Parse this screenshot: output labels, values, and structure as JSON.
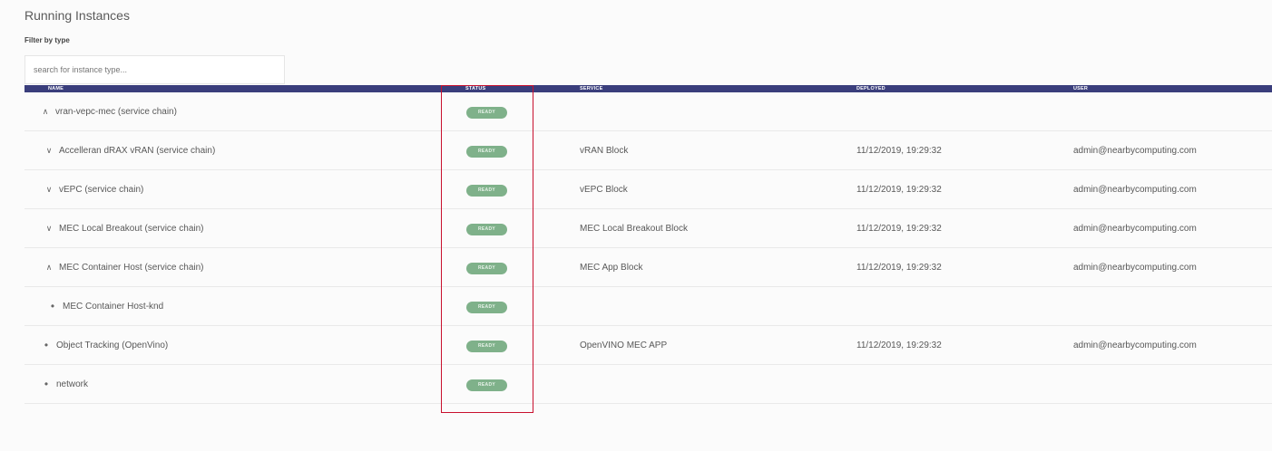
{
  "page": {
    "title": "Running Instances",
    "filter_label": "Filter by type",
    "search_placeholder": "search for instance type..."
  },
  "table": {
    "headers": {
      "name": "NAME",
      "status": "STATUS",
      "service": "SERVICE",
      "deployed": "DEPLOYED",
      "user": "USER"
    },
    "rows": [
      {
        "toggle": "^",
        "name": "vran-vepc-mec (service chain)",
        "status": "READY",
        "service": "",
        "deployed": "",
        "user": ""
      },
      {
        "toggle": "v",
        "name": "Accelleran dRAX vRAN (service chain)",
        "status": "READY",
        "service": "vRAN Block",
        "deployed": "11/12/2019, 19:29:32",
        "user": "admin@nearbycomputing.com"
      },
      {
        "toggle": "v",
        "name": "vEPC (service chain)",
        "status": "READY",
        "service": "vEPC Block",
        "deployed": "11/12/2019, 19:29:32",
        "user": "admin@nearbycomputing.com"
      },
      {
        "toggle": "v",
        "name": "MEC Local Breakout (service chain)",
        "status": "READY",
        "service": "MEC Local Breakout Block",
        "deployed": "11/12/2019, 19:29:32",
        "user": "admin@nearbycomputing.com"
      },
      {
        "toggle": "^",
        "name": "MEC Container Host (service chain)",
        "status": "READY",
        "service": "MEC App Block",
        "deployed": "11/12/2019, 19:29:32",
        "user": "admin@nearbycomputing.com"
      },
      {
        "toggle": "•",
        "name": "MEC Container Host-knd",
        "status": "READY",
        "service": "",
        "deployed": "",
        "user": ""
      },
      {
        "toggle": "•",
        "name": "Object Tracking (OpenVino)",
        "status": "READY",
        "service": "OpenVINO MEC APP",
        "deployed": "11/12/2019, 19:29:32",
        "user": "admin@nearbycomputing.com"
      },
      {
        "toggle": "•",
        "name": "network",
        "status": "READY",
        "service": "",
        "deployed": "",
        "user": ""
      }
    ]
  },
  "colors": {
    "header_bg": "#3a3e7c",
    "ready_badge": "#7fb18a",
    "highlight": "#c8102e"
  }
}
